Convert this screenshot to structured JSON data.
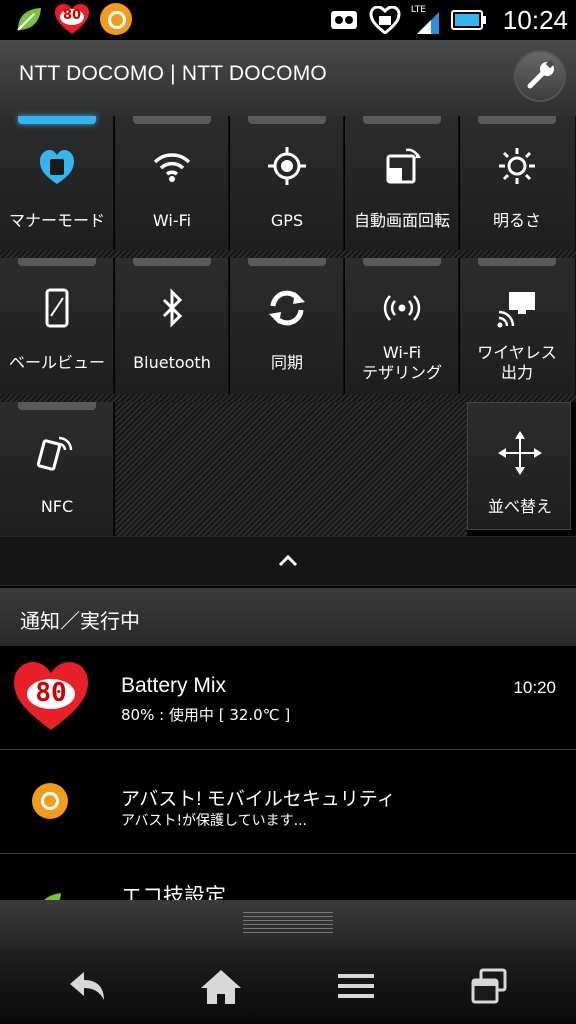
{
  "status_bar": {
    "time": "10:24",
    "battery_badge": "80",
    "network_label": "LTE",
    "left_icons": [
      "leaf-icon",
      "battery-mix-heart-icon",
      "avast-icon"
    ],
    "right_icons": [
      "incoming-call-icon",
      "heart-sync-icon",
      "lte-signal-icon",
      "battery-icon"
    ]
  },
  "header": {
    "title": "NTT DOCOMO | NTT DOCOMO",
    "settings_icon": "wrench-icon"
  },
  "toggles": [
    {
      "label": "マナーモード",
      "icon": "manner-mode-icon",
      "active": true
    },
    {
      "label": "Wi-Fi",
      "icon": "wifi-icon",
      "active": false
    },
    {
      "label": "GPS",
      "icon": "gps-icon",
      "active": false
    },
    {
      "label": "自動画面回転",
      "icon": "auto-rotate-icon",
      "active": false
    },
    {
      "label": "明るさ",
      "icon": "brightness-icon",
      "active": false
    },
    {
      "label": "ベールビュー",
      "icon": "veil-view-icon",
      "active": false
    },
    {
      "label": "Bluetooth",
      "icon": "bluetooth-icon",
      "active": false
    },
    {
      "label": "同期",
      "icon": "sync-icon",
      "active": false
    },
    {
      "label_line1": "Wi-Fi",
      "label_line2": "テザリング",
      "icon": "wifi-tethering-icon",
      "active": false
    },
    {
      "label_line1": "ワイヤレス",
      "label_line2": "出力",
      "icon": "wireless-output-icon",
      "active": false
    },
    {
      "label": "NFC",
      "icon": "nfc-icon",
      "active": false
    }
  ],
  "rearrange": {
    "label": "並べ替え",
    "icon": "move-arrows-icon"
  },
  "collapse_icon": "chevron-up-icon",
  "notifications_header": "通知／実行中",
  "notifications": [
    {
      "title": "Battery Mix",
      "subtitle": "80% : 使用中 [ 32.0℃ ]",
      "time": "10:20",
      "badge": "80",
      "icon": "battery-mix-heart-icon"
    },
    {
      "title": "アバスト! モバイルセキュリティ",
      "subtitle": "アバスト!が保護しています...",
      "icon": "avast-icon"
    },
    {
      "title": "エコ技設定",
      "icon": "eco-leaf-icon"
    }
  ],
  "navbar": [
    "back-icon",
    "home-icon",
    "menu-icon",
    "recent-apps-icon"
  ],
  "colors": {
    "accent": "#36b4ee",
    "heart_red": "#e8202a",
    "avast_orange": "#f29b1c"
  }
}
